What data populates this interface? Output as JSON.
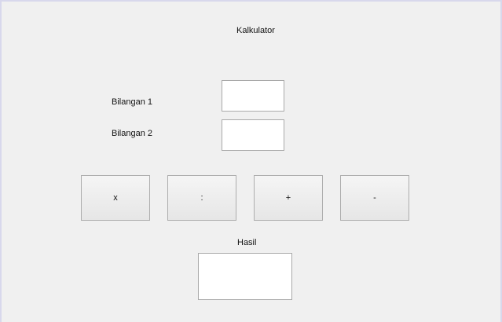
{
  "window": {
    "title": "Kalkulator"
  },
  "form": {
    "number1_label": "Bilangan 1",
    "number1_value": "",
    "number2_label": "Bilangan 2",
    "number2_value": "",
    "result_label": "Hasil",
    "result_value": ""
  },
  "buttons": {
    "multiply": "x",
    "divide": ":",
    "add": "+",
    "subtract": "-"
  },
  "icons": {},
  "colors": {
    "background": "#f0f0f0",
    "input_background": "#ffffff",
    "border": "#a9a9a9",
    "button_border": "#adadad"
  }
}
